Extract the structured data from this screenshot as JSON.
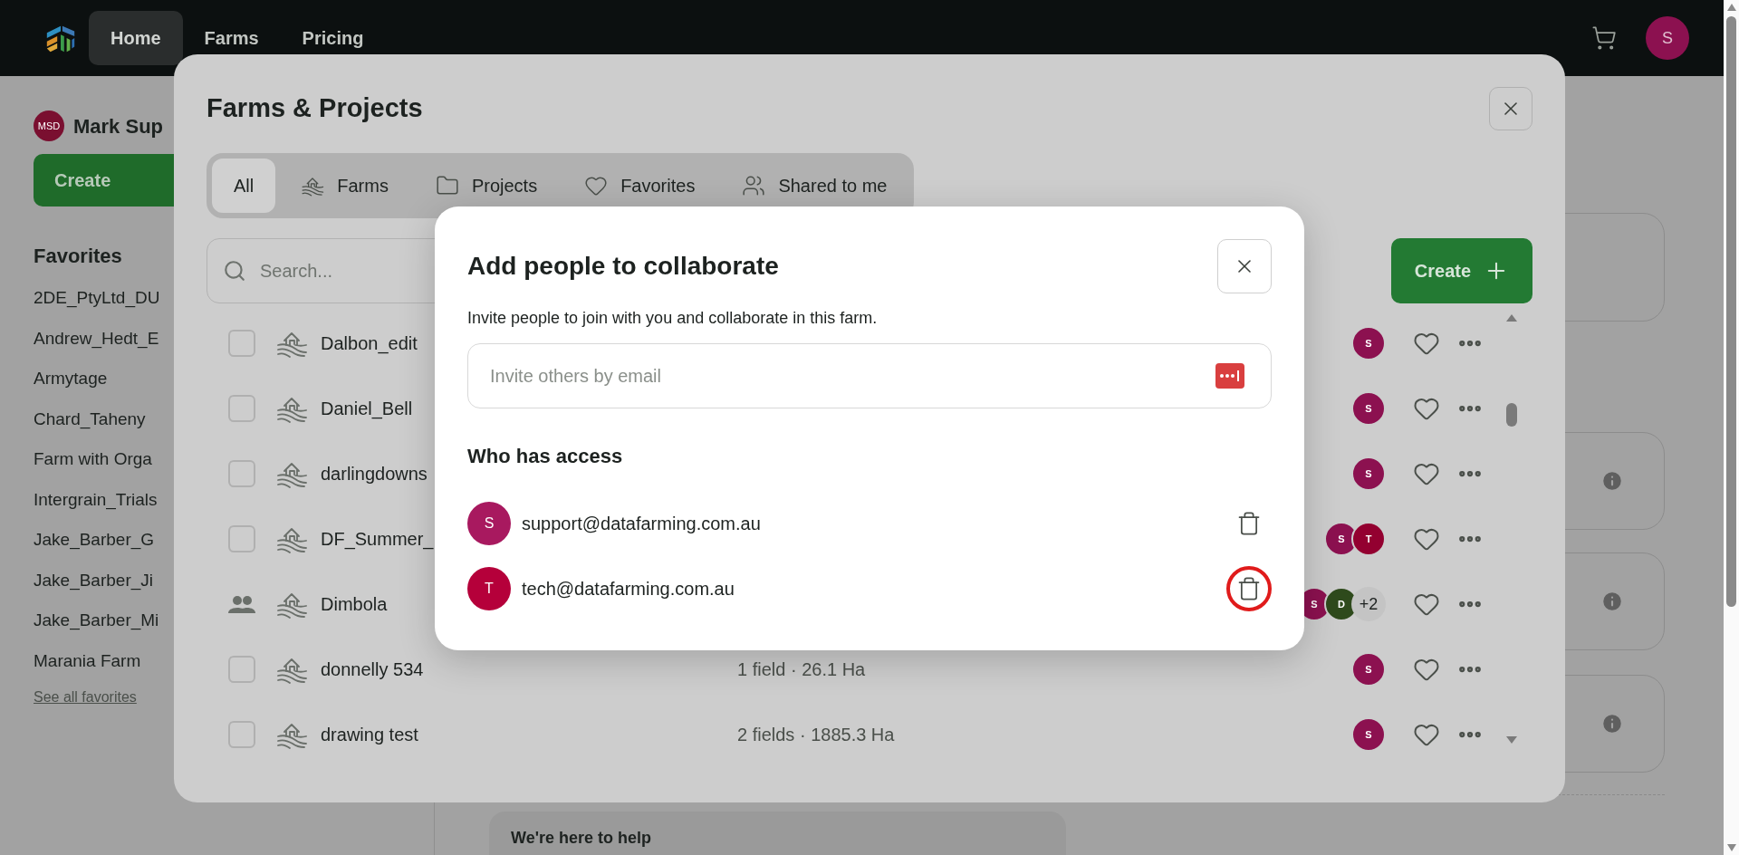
{
  "nav": {
    "items": [
      {
        "label": "Home",
        "selected": true
      },
      {
        "label": "Farms",
        "selected": false
      },
      {
        "label": "Pricing",
        "selected": false
      }
    ],
    "avatar": "S"
  },
  "sidebar": {
    "user_initials": "MSD",
    "user_name": "Mark Sup",
    "create_button": "Create",
    "favorites_title": "Favorites",
    "favorites": [
      "2DE_PtyLtd_DU",
      "Andrew_Hedt_E",
      "Armytage",
      "Chard_Taheny",
      "Farm with Orga",
      "Intergrain_Trials",
      "Jake_Barber_G",
      "Jake_Barber_Ji",
      "Jake_Barber_Mi",
      "Marania Farm"
    ],
    "see_all": "See all favorites"
  },
  "help_card": {
    "title": "We're here to help"
  },
  "farms_dialog": {
    "title": "Farms & Projects",
    "tabs": [
      {
        "label": "All",
        "kind": "plain",
        "selected": true
      },
      {
        "label": "Farms",
        "kind": "farm",
        "selected": false
      },
      {
        "label": "Projects",
        "kind": "folder",
        "selected": false
      },
      {
        "label": "Favorites",
        "kind": "heart",
        "selected": false
      },
      {
        "label": "Shared to me",
        "kind": "people",
        "selected": false
      }
    ],
    "search": {
      "placeholder": "Search..."
    },
    "create_button": "Create",
    "rows": [
      {
        "name": "Dalbon_edit",
        "kind": "checkbox",
        "checked": false,
        "members": [
          {
            "initial": "S",
            "color": "#8c1150"
          }
        ]
      },
      {
        "name": "Daniel_Bell",
        "kind": "checkbox",
        "checked": false,
        "members": [
          {
            "initial": "S",
            "color": "#8c1150"
          }
        ]
      },
      {
        "name": "darlingdowns",
        "kind": "checkbox",
        "checked": false,
        "members": [
          {
            "initial": "S",
            "color": "#8c1150"
          }
        ]
      },
      {
        "name": "DF_Summer_",
        "kind": "checkbox",
        "checked": false,
        "members": [
          {
            "initial": "S",
            "color": "#8c1150"
          },
          {
            "initial": "T",
            "color": "#930030"
          }
        ]
      },
      {
        "name": "Dimbola",
        "kind": "shared",
        "members": [
          {
            "initial": "S",
            "color": "#8c1150"
          },
          {
            "initial": "D",
            "color": "#2e4a1c"
          }
        ],
        "extra": "+2"
      },
      {
        "name": "donnelly 534",
        "kind": "checkbox",
        "checked": false,
        "details": "1 field · 26.1 Ha",
        "members": [
          {
            "initial": "S",
            "color": "#8c1150"
          }
        ]
      },
      {
        "name": "drawing test",
        "kind": "checkbox",
        "checked": false,
        "details": "2 fields · 1885.3 Ha",
        "members": [
          {
            "initial": "S",
            "color": "#8c1150"
          }
        ]
      }
    ]
  },
  "collaborate_dialog": {
    "title": "Add people to collaborate",
    "description": "Invite people to join with you and collaborate in this farm.",
    "invite": {
      "placeholder": "Invite others by email"
    },
    "access_title": "Who has access",
    "people": [
      {
        "initial": "S",
        "color": "#a8195f",
        "email": "support@datafarming.com.au",
        "highlighted": false
      },
      {
        "initial": "T",
        "color": "#b5003a",
        "email": "tech@datafarming.com.au",
        "highlighted": true
      }
    ]
  }
}
